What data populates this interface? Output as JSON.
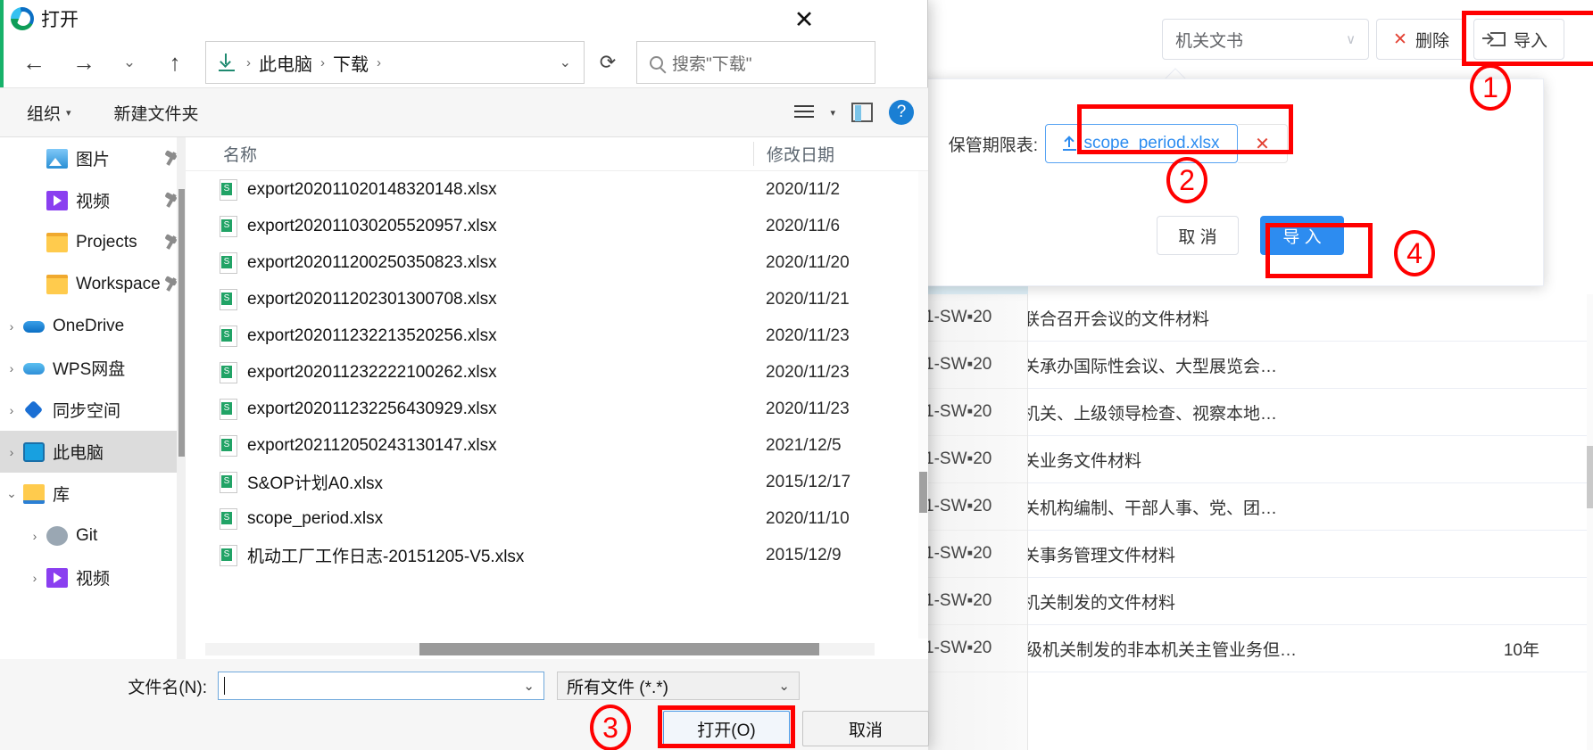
{
  "dialog": {
    "title": "打开",
    "close_label": "✕",
    "nav": {
      "back": "←",
      "forward": "→",
      "history": "⌄",
      "up": "↑",
      "refresh": "⟳",
      "address_chevron": "⌄",
      "breadcrumbs": [
        "此电脑",
        "下载"
      ],
      "breadcrumb_sep": "›",
      "address_leading_icon": "download-icon",
      "search_placeholder": "搜索\"下载\""
    },
    "command_bar": {
      "organize": "组织",
      "organize_caret": "▾",
      "new_folder": "新建文件夹",
      "view_caret": "▾",
      "help": "?"
    },
    "tree": [
      {
        "label": "图片",
        "icon": "picture-icon",
        "chevron": "",
        "pinned": true,
        "selected": false,
        "indent": 1
      },
      {
        "label": "视频",
        "icon": "video-icon",
        "chevron": "",
        "pinned": true,
        "selected": false,
        "indent": 1
      },
      {
        "label": "Projects",
        "icon": "folder-icon",
        "chevron": "",
        "pinned": true,
        "selected": false,
        "indent": 1
      },
      {
        "label": "Workspace",
        "icon": "folder-icon",
        "chevron": "",
        "pinned": true,
        "selected": false,
        "indent": 1
      },
      {
        "label": "OneDrive",
        "icon": "onedrive-icon",
        "chevron": "›",
        "pinned": false,
        "selected": false,
        "indent": 0
      },
      {
        "label": "WPS网盘",
        "icon": "wps-cloud-icon",
        "chevron": "›",
        "pinned": false,
        "selected": false,
        "indent": 0
      },
      {
        "label": "同步空间",
        "icon": "sync-icon",
        "chevron": "›",
        "pinned": false,
        "selected": false,
        "indent": 0
      },
      {
        "label": "此电脑",
        "icon": "computer-icon",
        "chevron": "›",
        "pinned": false,
        "selected": true,
        "indent": 0
      },
      {
        "label": "库",
        "icon": "library-icon",
        "chevron": "⌄",
        "pinned": false,
        "selected": false,
        "indent": 0
      },
      {
        "label": "Git",
        "icon": "git-icon",
        "chevron": "›",
        "pinned": false,
        "selected": false,
        "indent": 1
      },
      {
        "label": "视频",
        "icon": "video-icon",
        "chevron": "›",
        "pinned": false,
        "selected": false,
        "indent": 1
      }
    ],
    "file_list": {
      "columns": [
        "名称",
        "修改日期"
      ],
      "rows": [
        {
          "name": "export202011020148320148.xlsx",
          "date": "2020/11/2"
        },
        {
          "name": "export202011030205520957.xlsx",
          "date": "2020/11/6"
        },
        {
          "name": "export202011200250350823.xlsx",
          "date": "2020/11/20"
        },
        {
          "name": "export202011202301300708.xlsx",
          "date": "2020/11/21"
        },
        {
          "name": "export202011232213520256.xlsx",
          "date": "2020/11/23"
        },
        {
          "name": "export202011232222100262.xlsx",
          "date": "2020/11/23"
        },
        {
          "name": "export202011232256430929.xlsx",
          "date": "2020/11/23"
        },
        {
          "name": "export202112050243130147.xlsx",
          "date": "2021/12/5"
        },
        {
          "name": "S&OP计划A0.xlsx",
          "date": "2015/12/17"
        },
        {
          "name": "scope_period.xlsx",
          "date": "2020/11/10"
        },
        {
          "name": "机动工厂工作日志-20151205-V5.xlsx",
          "date": "2015/12/9"
        }
      ]
    },
    "footer": {
      "filename_label": "文件名(N):",
      "filename_value": "",
      "filename_chevron": "⌄",
      "filetype_value": "所有文件 (*.*)",
      "filetype_chevron": "⌄",
      "open_button": "打开(O)",
      "cancel_button": "取消"
    }
  },
  "app": {
    "toolbar": {
      "category_value": "机关文书",
      "category_chevron": "∨",
      "delete_label": "删除",
      "delete_x": "✕",
      "import_label": "导入"
    },
    "popover": {
      "field_label": "保管期限表:",
      "file_name": "scope_period.xlsx",
      "upload_icon": "upload-icon",
      "remove_label": "✕",
      "cancel_label": "取 消",
      "confirm_label": "导 入"
    },
    "background_rows": [
      {
        "code": "1-SW▪20",
        "label": "机关联合召开会议的文件材料",
        "years": ""
      },
      {
        "code": "1-SW▪20",
        "label": "本机关承办国际性会议、大型展览会…",
        "years": ""
      },
      {
        "code": "1-SW▪20",
        "label": "上级机关、上级领导检查、视察本地…",
        "years": ""
      },
      {
        "code": "1-SW▪20",
        "label": "本机关业务文件材料",
        "years": ""
      },
      {
        "code": "1-SW▪20",
        "label": "本机关机构编制、干部人事、党、团…",
        "years": ""
      },
      {
        "code": "1-SW▪20",
        "label": "本机关事务管理文件材料",
        "years": ""
      },
      {
        "code": "1-SW▪20",
        "label": "上级机关制发的文件材料",
        "years": ""
      },
      {
        "code": "1-SW▪20",
        "label": "同级机关制发的非本机关主管业务但…",
        "years": "10年"
      }
    ],
    "row_expand_icon": "▶",
    "row_back_icon": "←"
  },
  "annotations": {
    "markers": [
      "1",
      "2",
      "3",
      "4"
    ],
    "highlight_color": "#ff0000"
  }
}
